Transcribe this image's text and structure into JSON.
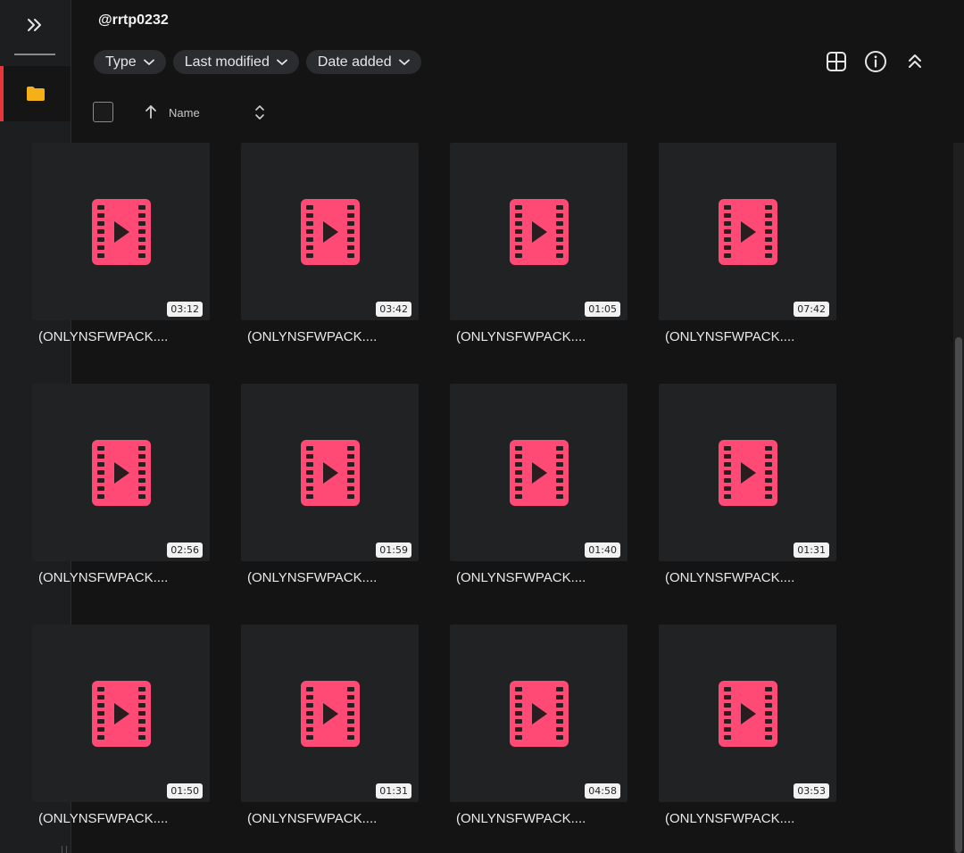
{
  "sidebar": {
    "expand_icon": "double-chevron-right-icon",
    "active_item_icon": "folder-icon",
    "accent_color": "#e8343a",
    "folder_color": "#f5b018"
  },
  "header": {
    "title": "@rrtp0232"
  },
  "filters": [
    {
      "label": "Type",
      "icon": "chevron-down-icon"
    },
    {
      "label": "Last modified",
      "icon": "chevron-down-icon"
    },
    {
      "label": "Date added",
      "icon": "chevron-down-icon"
    }
  ],
  "toolbar": {
    "icons": [
      "grid-view-icon",
      "info-icon",
      "collapse-up-icon"
    ]
  },
  "list_header": {
    "sort_direction": "ascending",
    "column_label": "Name"
  },
  "video_icon_color": "#ff4a76",
  "files": [
    {
      "name": "(ONLYNSFWPACK....",
      "duration": "03:12"
    },
    {
      "name": "(ONLYNSFWPACK....",
      "duration": "03:42"
    },
    {
      "name": "(ONLYNSFWPACK....",
      "duration": "01:05"
    },
    {
      "name": "(ONLYNSFWPACK....",
      "duration": "07:42"
    },
    {
      "name": "(ONLYNSFWPACK....",
      "duration": "02:56"
    },
    {
      "name": "(ONLYNSFWPACK....",
      "duration": "01:59"
    },
    {
      "name": "(ONLYNSFWPACK....",
      "duration": "01:40"
    },
    {
      "name": "(ONLYNSFWPACK....",
      "duration": "01:31"
    },
    {
      "name": "(ONLYNSFWPACK....",
      "duration": "01:50"
    },
    {
      "name": "(ONLYNSFWPACK....",
      "duration": "01:31"
    },
    {
      "name": "(ONLYNSFWPACK....",
      "duration": "04:58"
    },
    {
      "name": "(ONLYNSFWPACK....",
      "duration": "03:53"
    }
  ]
}
